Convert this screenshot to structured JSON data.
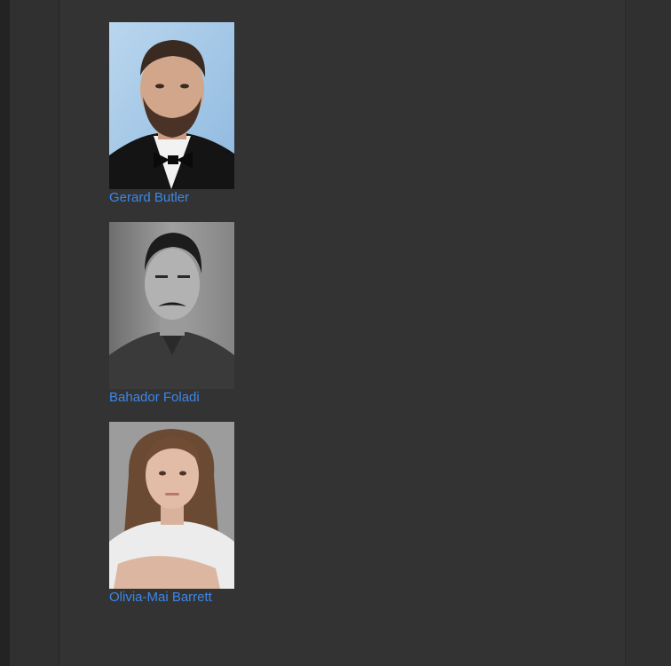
{
  "cast": [
    {
      "name": "Gerard Butler",
      "photo_alt": "Gerard Butler"
    },
    {
      "name": "Bahador Foladi",
      "photo_alt": "Bahador Foladi"
    },
    {
      "name": "Olivia-Mai Barrett",
      "photo_alt": "Olivia-Mai Barrett"
    }
  ],
  "colors": {
    "page_background": "#333333",
    "link": "#3c87e8"
  }
}
